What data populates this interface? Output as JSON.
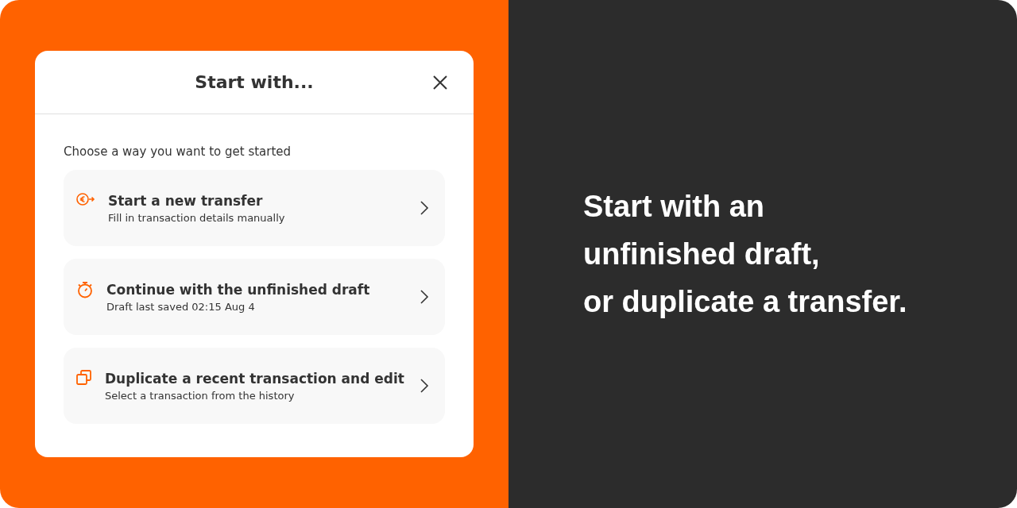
{
  "dialog": {
    "title": "Start with...",
    "prompt": "Choose a way you want to get started",
    "options": [
      {
        "kind": "transfer",
        "title": "Start a new transfer",
        "subtitle": "Fill in transaction details manually"
      },
      {
        "kind": "draft",
        "title": "Continue with the unfinished draft",
        "subtitle": "Draft last saved 02:15 Aug 4"
      },
      {
        "kind": "duplicate",
        "title": "Duplicate a recent transaction and edit",
        "subtitle": "Select a transaction from the history"
      }
    ]
  },
  "headline": [
    "Start with an",
    "unfinished draft,",
    "or duplicate a transfer."
  ]
}
